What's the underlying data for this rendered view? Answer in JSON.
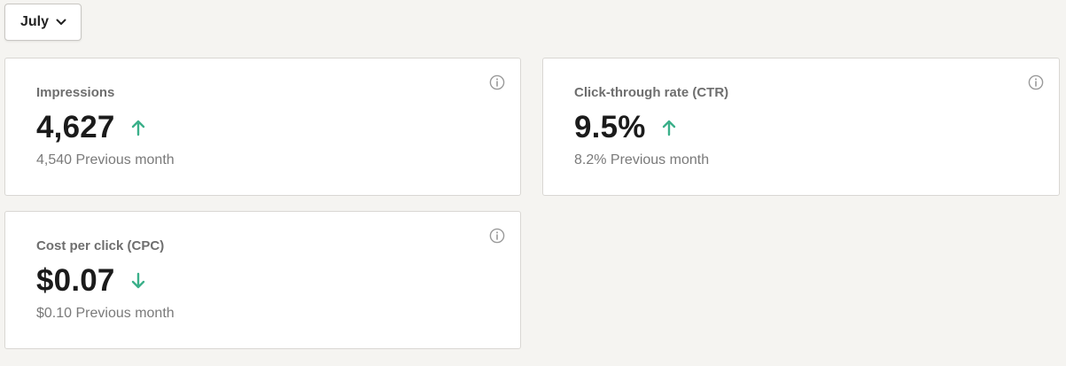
{
  "month_selector": {
    "label": "July",
    "icon": "chevron-down-icon"
  },
  "colors": {
    "background": "#f5f4f1",
    "card_background": "#ffffff",
    "trend_green": "#3bb08a",
    "title_gray": "#6e6e6e",
    "value_black": "#1b1b1b"
  },
  "cards": [
    {
      "title": "Impressions",
      "value": "4,627",
      "trend": "up",
      "trend_icon": "arrow-up-icon",
      "previous_value": "4,540",
      "previous_label": "Previous month",
      "info_icon": "info-icon"
    },
    {
      "title": "Click-through rate (CTR)",
      "value": "9.5%",
      "trend": "up",
      "trend_icon": "arrow-up-icon",
      "previous_value": "8.2%",
      "previous_label": "Previous month",
      "info_icon": "info-icon"
    },
    {
      "title": "Cost per click (CPC)",
      "value": "$0.07",
      "trend": "down",
      "trend_icon": "arrow-down-icon",
      "previous_value": "$0.10",
      "previous_label": "Previous month",
      "info_icon": "info-icon"
    }
  ]
}
